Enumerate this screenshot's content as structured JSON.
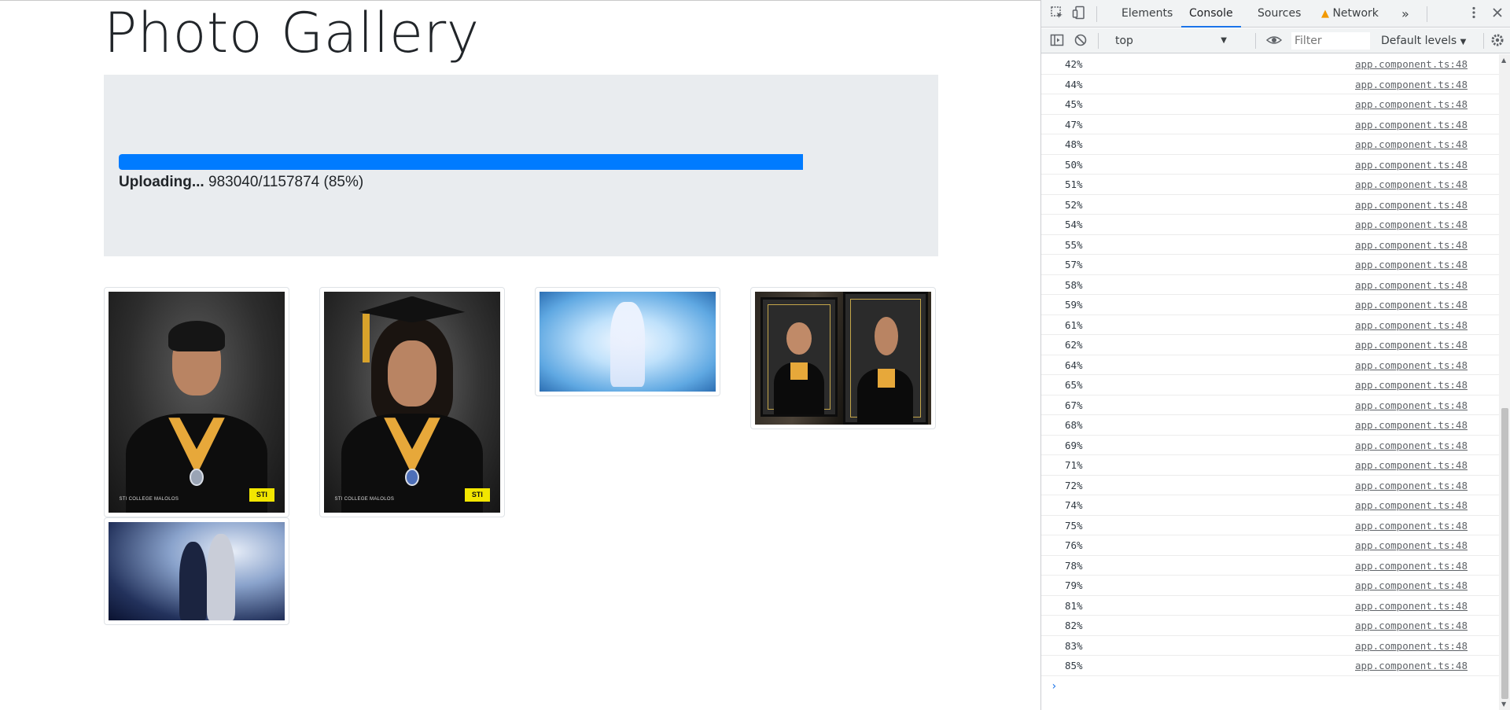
{
  "page": {
    "title": "Photo Gallery",
    "upload": {
      "label": "Uploading...",
      "detail": "983040/1157874 (85%)",
      "progress_percent": 85,
      "bar_color": "#007bff"
    },
    "photos": [
      {
        "school_text": "STI COLLEGE MALOLOS",
        "logo_text": "STI"
      },
      {
        "school_text": "STI COLLEGE MALOLOS",
        "logo_text": "STI"
      },
      {},
      {},
      {}
    ]
  },
  "devtools": {
    "tabs": [
      "Elements",
      "Console",
      "Sources",
      "Network"
    ],
    "active_tab": "Console",
    "more_tabs_icon": "»",
    "context": "top",
    "filter_placeholder": "Filter",
    "levels": "Default levels",
    "logs": [
      {
        "msg": "42%",
        "src": "app.component.ts:48"
      },
      {
        "msg": "44%",
        "src": "app.component.ts:48"
      },
      {
        "msg": "45%",
        "src": "app.component.ts:48"
      },
      {
        "msg": "47%",
        "src": "app.component.ts:48"
      },
      {
        "msg": "48%",
        "src": "app.component.ts:48"
      },
      {
        "msg": "50%",
        "src": "app.component.ts:48"
      },
      {
        "msg": "51%",
        "src": "app.component.ts:48"
      },
      {
        "msg": "52%",
        "src": "app.component.ts:48"
      },
      {
        "msg": "54%",
        "src": "app.component.ts:48"
      },
      {
        "msg": "55%",
        "src": "app.component.ts:48"
      },
      {
        "msg": "57%",
        "src": "app.component.ts:48"
      },
      {
        "msg": "58%",
        "src": "app.component.ts:48"
      },
      {
        "msg": "59%",
        "src": "app.component.ts:48"
      },
      {
        "msg": "61%",
        "src": "app.component.ts:48"
      },
      {
        "msg": "62%",
        "src": "app.component.ts:48"
      },
      {
        "msg": "64%",
        "src": "app.component.ts:48"
      },
      {
        "msg": "65%",
        "src": "app.component.ts:48"
      },
      {
        "msg": "67%",
        "src": "app.component.ts:48"
      },
      {
        "msg": "68%",
        "src": "app.component.ts:48"
      },
      {
        "msg": "69%",
        "src": "app.component.ts:48"
      },
      {
        "msg": "71%",
        "src": "app.component.ts:48"
      },
      {
        "msg": "72%",
        "src": "app.component.ts:48"
      },
      {
        "msg": "74%",
        "src": "app.component.ts:48"
      },
      {
        "msg": "75%",
        "src": "app.component.ts:48"
      },
      {
        "msg": "76%",
        "src": "app.component.ts:48"
      },
      {
        "msg": "78%",
        "src": "app.component.ts:48"
      },
      {
        "msg": "79%",
        "src": "app.component.ts:48"
      },
      {
        "msg": "81%",
        "src": "app.component.ts:48"
      },
      {
        "msg": "82%",
        "src": "app.component.ts:48"
      },
      {
        "msg": "83%",
        "src": "app.component.ts:48"
      },
      {
        "msg": "85%",
        "src": "app.component.ts:48"
      }
    ],
    "prompt": "›"
  }
}
